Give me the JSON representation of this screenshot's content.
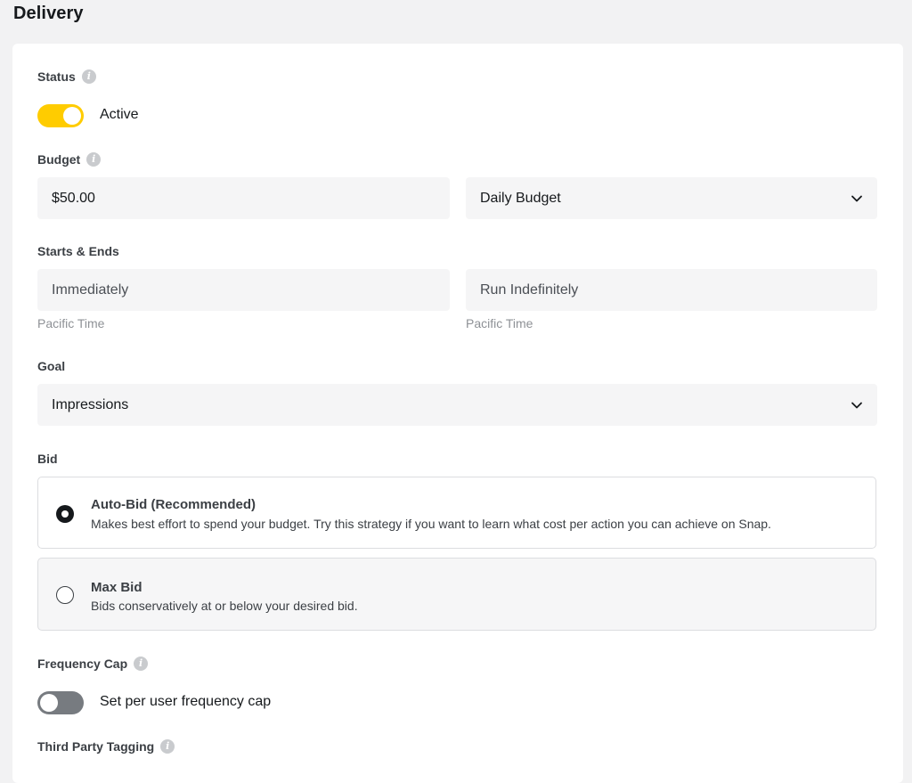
{
  "page": {
    "title": "Delivery"
  },
  "status": {
    "label": "Status",
    "value": "Active",
    "enabled": true
  },
  "budget": {
    "label": "Budget",
    "amount": "$50.00",
    "type": "Daily Budget"
  },
  "schedule": {
    "label": "Starts & Ends",
    "start": "Immediately",
    "end": "Run Indefinitely",
    "start_timezone": "Pacific Time",
    "end_timezone": "Pacific Time"
  },
  "goal": {
    "label": "Goal",
    "value": "Impressions"
  },
  "bid": {
    "label": "Bid",
    "options": [
      {
        "title": "Auto-Bid (Recommended)",
        "description": "Makes best effort to spend your budget. Try this strategy if you want to learn what cost per action you can achieve on Snap.",
        "selected": true
      },
      {
        "title": "Max Bid",
        "description": "Bids conservatively at or below your desired bid.",
        "selected": false
      }
    ]
  },
  "frequency_cap": {
    "label": "Frequency Cap",
    "toggle_text": "Set per user frequency cap",
    "enabled": false
  },
  "third_party_tagging": {
    "label": "Third Party Tagging"
  },
  "icons": {
    "info": "info-icon",
    "dropdown": "chevron-down-icon"
  },
  "colors": {
    "toggle_on": "#ffcc00",
    "toggle_off": "#777b80",
    "field_bg": "#f5f5f6"
  }
}
